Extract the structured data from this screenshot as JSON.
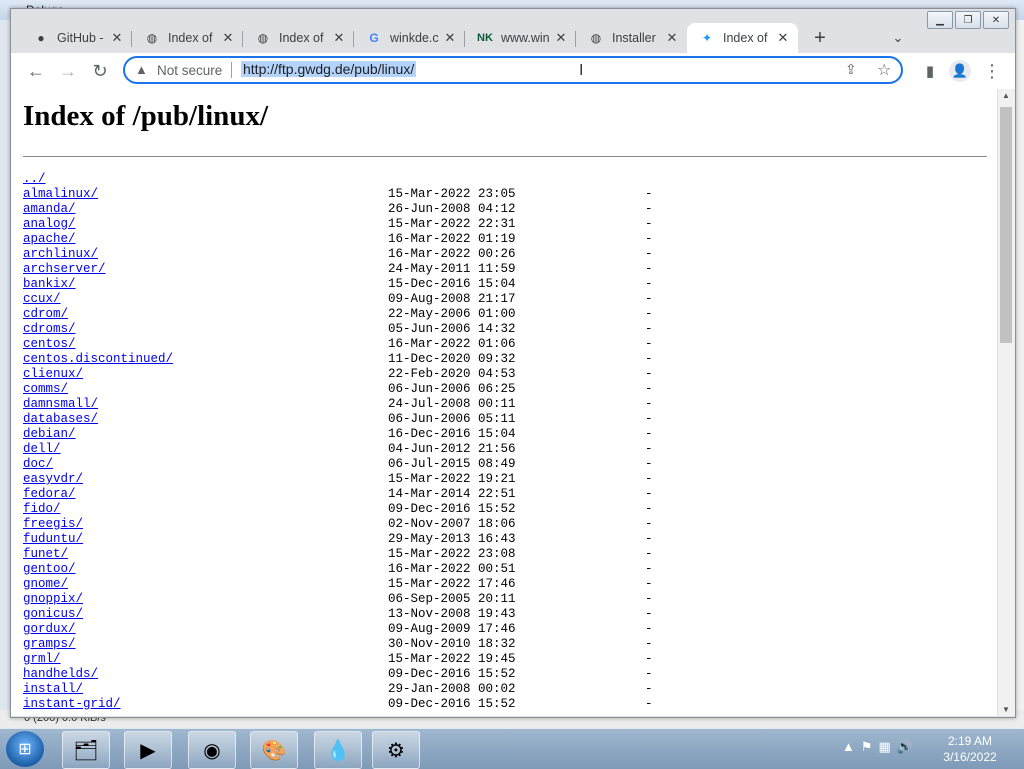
{
  "background_app": {
    "title": "Deluge",
    "status": "0 (200)   0.0 KiB/s"
  },
  "tabs": [
    {
      "label": "GitHub -",
      "icon": "github-icon",
      "active": false
    },
    {
      "label": "Index of",
      "icon": "globe-icon",
      "active": false
    },
    {
      "label": "Index of",
      "icon": "globe-icon",
      "active": false
    },
    {
      "label": "winkde.c",
      "icon": "google-icon",
      "active": false
    },
    {
      "label": "www.win",
      "icon": "nk-icon",
      "active": false
    },
    {
      "label": "Installer",
      "icon": "globe-icon",
      "active": false
    },
    {
      "label": "Index of",
      "icon": "kde-icon",
      "active": true
    }
  ],
  "toolbar": {
    "not_secure": "Not secure",
    "url": "http://ftp.gwdg.de/pub/linux/"
  },
  "page": {
    "title": "Index of /pub/linux/",
    "parent": "../",
    "entries": [
      {
        "name": "almalinux/",
        "date": "15-Mar-2022 23:05",
        "size": "-"
      },
      {
        "name": "amanda/",
        "date": "26-Jun-2008 04:12",
        "size": "-"
      },
      {
        "name": "analog/",
        "date": "15-Mar-2022 22:31",
        "size": "-"
      },
      {
        "name": "apache/",
        "date": "16-Mar-2022 01:19",
        "size": "-"
      },
      {
        "name": "archlinux/",
        "date": "16-Mar-2022 00:26",
        "size": "-"
      },
      {
        "name": "archserver/",
        "date": "24-May-2011 11:59",
        "size": "-"
      },
      {
        "name": "bankix/",
        "date": "15-Dec-2016 15:04",
        "size": "-"
      },
      {
        "name": "ccux/",
        "date": "09-Aug-2008 21:17",
        "size": "-"
      },
      {
        "name": "cdrom/",
        "date": "22-May-2006 01:00",
        "size": "-"
      },
      {
        "name": "cdroms/",
        "date": "05-Jun-2006 14:32",
        "size": "-"
      },
      {
        "name": "centos/",
        "date": "16-Mar-2022 01:06",
        "size": "-"
      },
      {
        "name": "centos.discontinued/",
        "date": "11-Dec-2020 09:32",
        "size": "-"
      },
      {
        "name": "clienux/",
        "date": "22-Feb-2020 04:53",
        "size": "-"
      },
      {
        "name": "comms/",
        "date": "06-Jun-2006 06:25",
        "size": "-"
      },
      {
        "name": "damnsmall/",
        "date": "24-Jul-2008 00:11",
        "size": "-"
      },
      {
        "name": "databases/",
        "date": "06-Jun-2006 05:11",
        "size": "-"
      },
      {
        "name": "debian/",
        "date": "16-Dec-2016 15:04",
        "size": "-"
      },
      {
        "name": "dell/",
        "date": "04-Jun-2012 21:56",
        "size": "-"
      },
      {
        "name": "doc/",
        "date": "06-Jul-2015 08:49",
        "size": "-"
      },
      {
        "name": "easyvdr/",
        "date": "15-Mar-2022 19:21",
        "size": "-"
      },
      {
        "name": "fedora/",
        "date": "14-Mar-2014 22:51",
        "size": "-"
      },
      {
        "name": "fido/",
        "date": "09-Dec-2016 15:52",
        "size": "-"
      },
      {
        "name": "freegis/",
        "date": "02-Nov-2007 18:06",
        "size": "-"
      },
      {
        "name": "fuduntu/",
        "date": "29-May-2013 16:43",
        "size": "-"
      },
      {
        "name": "funet/",
        "date": "15-Mar-2022 23:08",
        "size": "-"
      },
      {
        "name": "gentoo/",
        "date": "16-Mar-2022 00:51",
        "size": "-"
      },
      {
        "name": "gnome/",
        "date": "15-Mar-2022 17:46",
        "size": "-"
      },
      {
        "name": "gnoppix/",
        "date": "06-Sep-2005 20:11",
        "size": "-"
      },
      {
        "name": "gonicus/",
        "date": "13-Nov-2008 19:43",
        "size": "-"
      },
      {
        "name": "gordux/",
        "date": "09-Aug-2009 17:46",
        "size": "-"
      },
      {
        "name": "gramps/",
        "date": "30-Nov-2010 18:32",
        "size": "-"
      },
      {
        "name": "grml/",
        "date": "15-Mar-2022 19:45",
        "size": "-"
      },
      {
        "name": "handhelds/",
        "date": "09-Dec-2016 15:52",
        "size": "-"
      },
      {
        "name": "install/",
        "date": "29-Jan-2008 00:02",
        "size": "-"
      },
      {
        "name": "instant-grid/",
        "date": "09-Dec-2016 15:52",
        "size": "-"
      }
    ]
  },
  "taskbar": {
    "items": [
      {
        "name": "explorer-icon",
        "glyph": "🗂"
      },
      {
        "name": "media-player-icon",
        "glyph": "▶"
      },
      {
        "name": "chrome-icon",
        "glyph": "◉"
      },
      {
        "name": "paint-icon",
        "glyph": "🎨"
      },
      {
        "name": "drop-icon",
        "glyph": "💧"
      },
      {
        "name": "kde-icon",
        "glyph": "⚙"
      }
    ],
    "time": "2:19 AM",
    "date": "3/16/2022"
  }
}
